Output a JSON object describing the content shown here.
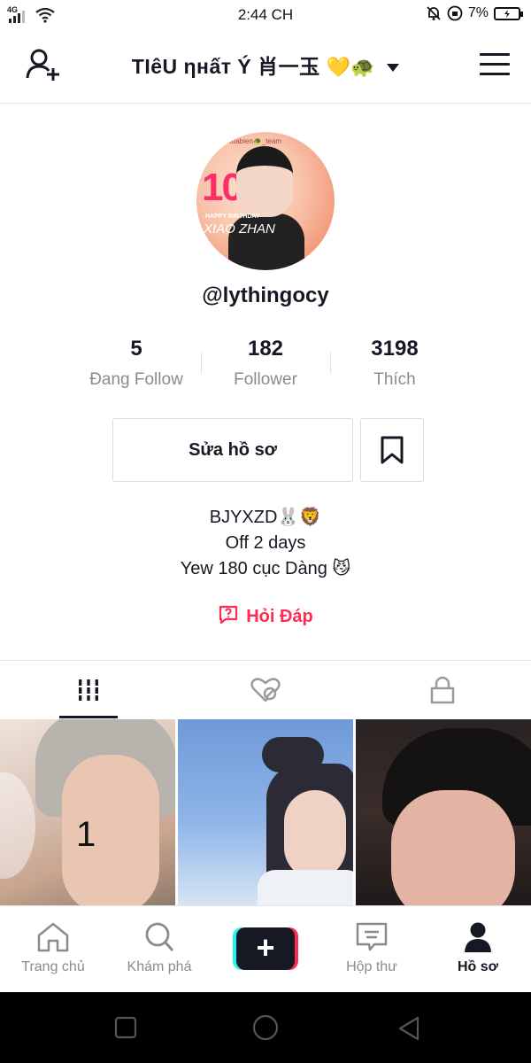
{
  "status_bar": {
    "network": "4G",
    "time": "2:44 CH",
    "battery": "7%"
  },
  "header": {
    "title": "TIêU ηнấт Ý 肖一玉",
    "title_emoji": "💛🐢"
  },
  "avatar": {
    "team_text": "Ruabien🐢_team",
    "number_text": "1005",
    "caption_small": "HAPPY BIRTHDAY",
    "caption_name": "XIAO ZHAN"
  },
  "profile": {
    "username": "@lythingocy"
  },
  "stats": [
    {
      "value": "5",
      "label": "Đang Follow"
    },
    {
      "value": "182",
      "label": "Follower"
    },
    {
      "value": "3198",
      "label": "Thích"
    }
  ],
  "actions": {
    "edit_profile": "Sửa hồ sơ"
  },
  "bio": {
    "line1": "BJYXZD🐰🦁",
    "line2": "Off 2 days",
    "line3": "Yew 180 cục Dàng 😼"
  },
  "qa_label": "Hỏi Đáp",
  "grid": {
    "first_overlay": "1"
  },
  "bottom_nav": [
    {
      "label": "Trang chủ",
      "icon": "home-icon"
    },
    {
      "label": "Khám phá",
      "icon": "search-icon"
    },
    {
      "label": "",
      "icon": "plus-icon"
    },
    {
      "label": "Hộp thư",
      "icon": "inbox-icon"
    },
    {
      "label": "Hồ sơ",
      "icon": "profile-icon"
    }
  ],
  "colors": {
    "accent": "#fe2c55",
    "text": "#161823",
    "muted": "#8a8b91"
  }
}
